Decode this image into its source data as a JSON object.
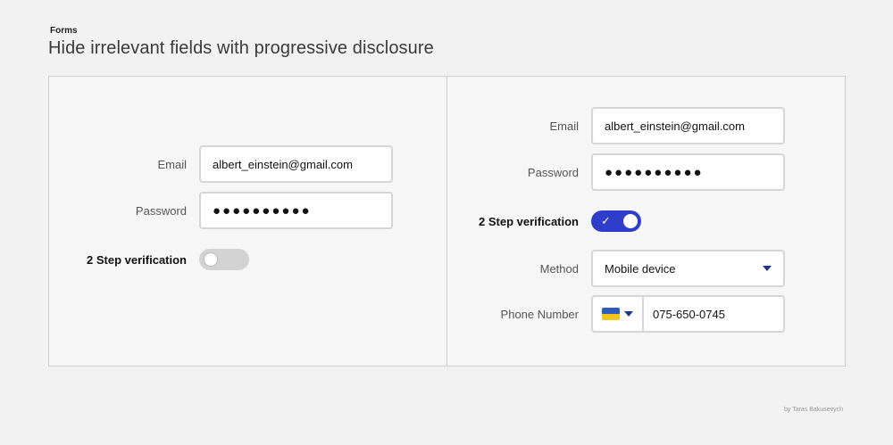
{
  "eyebrow": "Forms",
  "headline": "Hide irrelevant fields with progressive disclosure",
  "left_form": {
    "email_label": "Email",
    "email_value": "albert_einstein@gmail.com",
    "password_label": "Password",
    "password_value": "●●●●●●●●●●",
    "two_step_label": "2 Step verification",
    "two_step_enabled": false
  },
  "right_form": {
    "email_label": "Email",
    "email_value": "albert_einstein@gmail.com",
    "password_label": "Password",
    "password_value": "●●●●●●●●●●",
    "two_step_label": "2 Step verification",
    "two_step_enabled": true,
    "check_glyph": "✓",
    "method_label": "Method",
    "method_value": "Mobile device",
    "phone_label": "Phone Number",
    "phone_value": "075-650-0745",
    "flag_colors": [
      "#2f5bbf",
      "#f2c51a"
    ]
  },
  "credit": "by Taras Bakusevych",
  "colors": {
    "toggle_on": "#2f3dcc",
    "toggle_off": "#d3d3d3",
    "caret": "#22328f"
  }
}
